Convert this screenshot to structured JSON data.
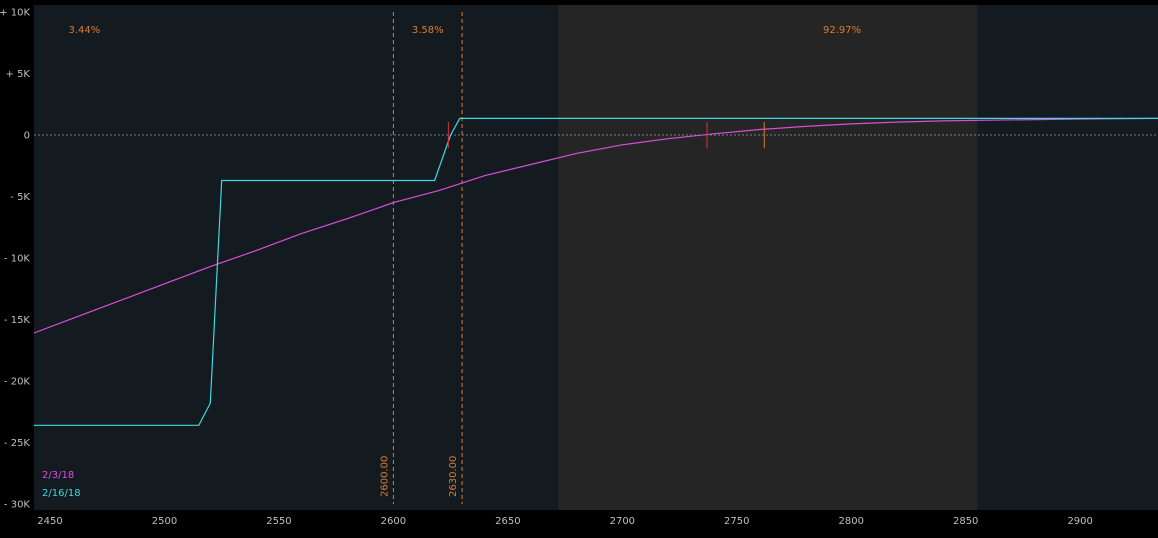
{
  "chart_data": {
    "type": "line",
    "xlim": [
      2443,
      2934
    ],
    "ylim": [
      -30000,
      10000
    ],
    "yticks": [
      {
        "value": 10000,
        "label": "+ 10K"
      },
      {
        "value": 5000,
        "label": "+ 5K"
      },
      {
        "value": 0,
        "label": "0"
      },
      {
        "value": -5000,
        "label": "- 5K"
      },
      {
        "value": -10000,
        "label": "- 10K"
      },
      {
        "value": -15000,
        "label": "- 15K"
      },
      {
        "value": -20000,
        "label": "- 20K"
      },
      {
        "value": -25000,
        "label": "- 25K"
      },
      {
        "value": -30000,
        "label": "- 30K"
      }
    ],
    "xticks": [
      {
        "value": 2450,
        "label": "2450"
      },
      {
        "value": 2500,
        "label": "2500"
      },
      {
        "value": 2550,
        "label": "2550"
      },
      {
        "value": 2600,
        "label": "2600"
      },
      {
        "value": 2650,
        "label": "2650"
      },
      {
        "value": 2700,
        "label": "2700"
      },
      {
        "value": 2750,
        "label": "2750"
      },
      {
        "value": 2800,
        "label": "2800"
      },
      {
        "value": 2850,
        "label": "2850"
      },
      {
        "value": 2900,
        "label": "2900"
      }
    ],
    "shaded_region": [
      2672,
      2855
    ],
    "vertical_lines": [
      {
        "x": 2600,
        "label": "2600.00"
      },
      {
        "x": 2630,
        "label": "2630.00"
      }
    ],
    "probabilities": [
      {
        "x": 2465,
        "label": "3.44%"
      },
      {
        "x": 2615,
        "label": "3.58%"
      },
      {
        "x": 2796,
        "label": "92.97%"
      }
    ],
    "series": [
      {
        "name": "2/3/18",
        "color": "#d94ed9",
        "x": [
          2443,
          2460,
          2480,
          2500,
          2520,
          2540,
          2560,
          2580,
          2600,
          2620,
          2640,
          2660,
          2680,
          2700,
          2720,
          2740,
          2760,
          2780,
          2800,
          2820,
          2840,
          2860,
          2880,
          2900,
          2934
        ],
        "y": [
          -16100,
          -14900,
          -13500,
          -12100,
          -10700,
          -9400,
          -8000,
          -6800,
          -5500,
          -4500,
          -3300,
          -2400,
          -1500,
          -800,
          -300,
          100,
          450,
          700,
          900,
          1050,
          1150,
          1200,
          1250,
          1300,
          1350
        ]
      },
      {
        "name": "2/16/18",
        "color": "#3fd7e0",
        "x": [
          2443,
          2515,
          2520,
          2525,
          2618,
          2625,
          2629,
          2934
        ],
        "y": [
          -23600,
          -23600,
          -21800,
          -3700,
          -3700,
          0,
          1350,
          1350
        ]
      }
    ],
    "markers": [
      {
        "x": 2624,
        "y": 0,
        "color": "#e03030"
      },
      {
        "x": 2737,
        "y": 0,
        "color": "#e03030"
      },
      {
        "x": 2762,
        "y": 0,
        "color": "#e07a2a"
      }
    ]
  }
}
